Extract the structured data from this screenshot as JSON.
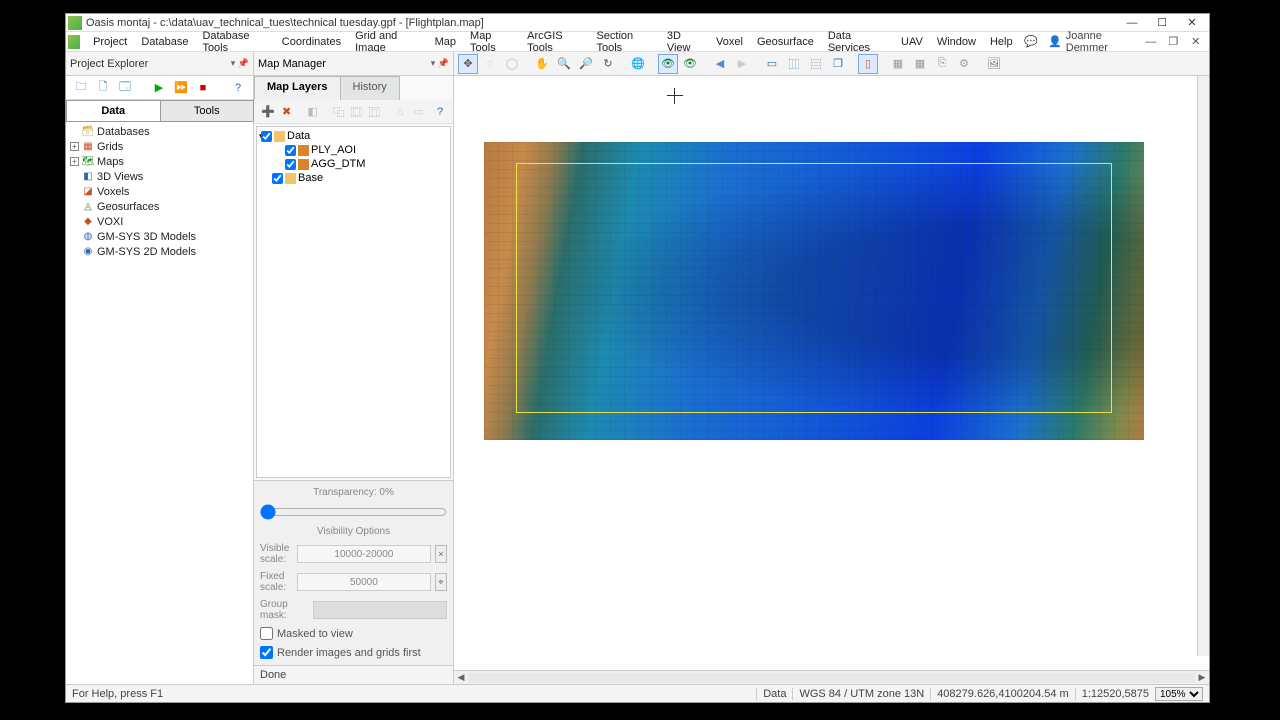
{
  "title": "Oasis montaj - c:\\data\\uav_technical_tues\\technical tuesday.gpf - [Flightplan.map]",
  "menus": [
    "Project",
    "Database",
    "Database Tools",
    "Coordinates",
    "Grid and Image",
    "Map",
    "Map Tools",
    "ArcGIS Tools",
    "Section Tools",
    "3D View",
    "Voxel",
    "Geosurface",
    "Data Services",
    "UAV",
    "Window",
    "Help"
  ],
  "user": "Joanne Demmer",
  "panels": {
    "explorer": "Project Explorer",
    "mapmgr": "Map Manager"
  },
  "explorer": {
    "tabs": [
      "Data",
      "Tools"
    ],
    "nodes": [
      {
        "label": "Databases",
        "icon": "db"
      },
      {
        "label": "Grids",
        "icon": "grid",
        "exp": true
      },
      {
        "label": "Maps",
        "icon": "map",
        "exp": true
      },
      {
        "label": "3D Views",
        "icon": "cube"
      },
      {
        "label": "Voxels",
        "icon": "vox"
      },
      {
        "label": "Geosurfaces",
        "icon": "surf"
      },
      {
        "label": "VOXI",
        "icon": "voxi"
      },
      {
        "label": "GM-SYS 3D Models",
        "icon": "gm3"
      },
      {
        "label": "GM-SYS 2D Models",
        "icon": "gm2"
      }
    ]
  },
  "mapmgr": {
    "tabs": [
      "Map Layers",
      "History"
    ],
    "root": "Data",
    "layers": [
      "PLY_AOI",
      "AGG_DTM"
    ],
    "base": "Base",
    "transparency_label": "Transparency: 0%",
    "visibility_label": "Visibility Options",
    "visible_scale_label": "Visible scale:",
    "visible_scale_value": "10000-20000",
    "fixed_scale_label": "Fixed scale:",
    "fixed_scale_value": "50000",
    "group_mask_label": "Group mask:",
    "masked_label": "Masked to view",
    "render_label": "Render images and grids first",
    "done": "Done"
  },
  "status": {
    "help": "For Help, press F1",
    "data": "Data",
    "crs": "WGS 84 / UTM zone 13N",
    "coords": "408279.626,4100204.54 m",
    "scale": "1:12520,5875",
    "zoom": "105%"
  },
  "chart_data": {
    "type": "map",
    "title": "AGG_DTM shaded relief with PLY_AOI rectangle overlay",
    "crs": "WGS 84 / UTM zone 13N",
    "cursor_easting": 408279.626,
    "cursor_northing": 4100204.54,
    "display_scale": "1:12520.5875",
    "zoom_pct": 105,
    "layers": [
      "PLY_AOI",
      "AGG_DTM",
      "Base"
    ]
  }
}
